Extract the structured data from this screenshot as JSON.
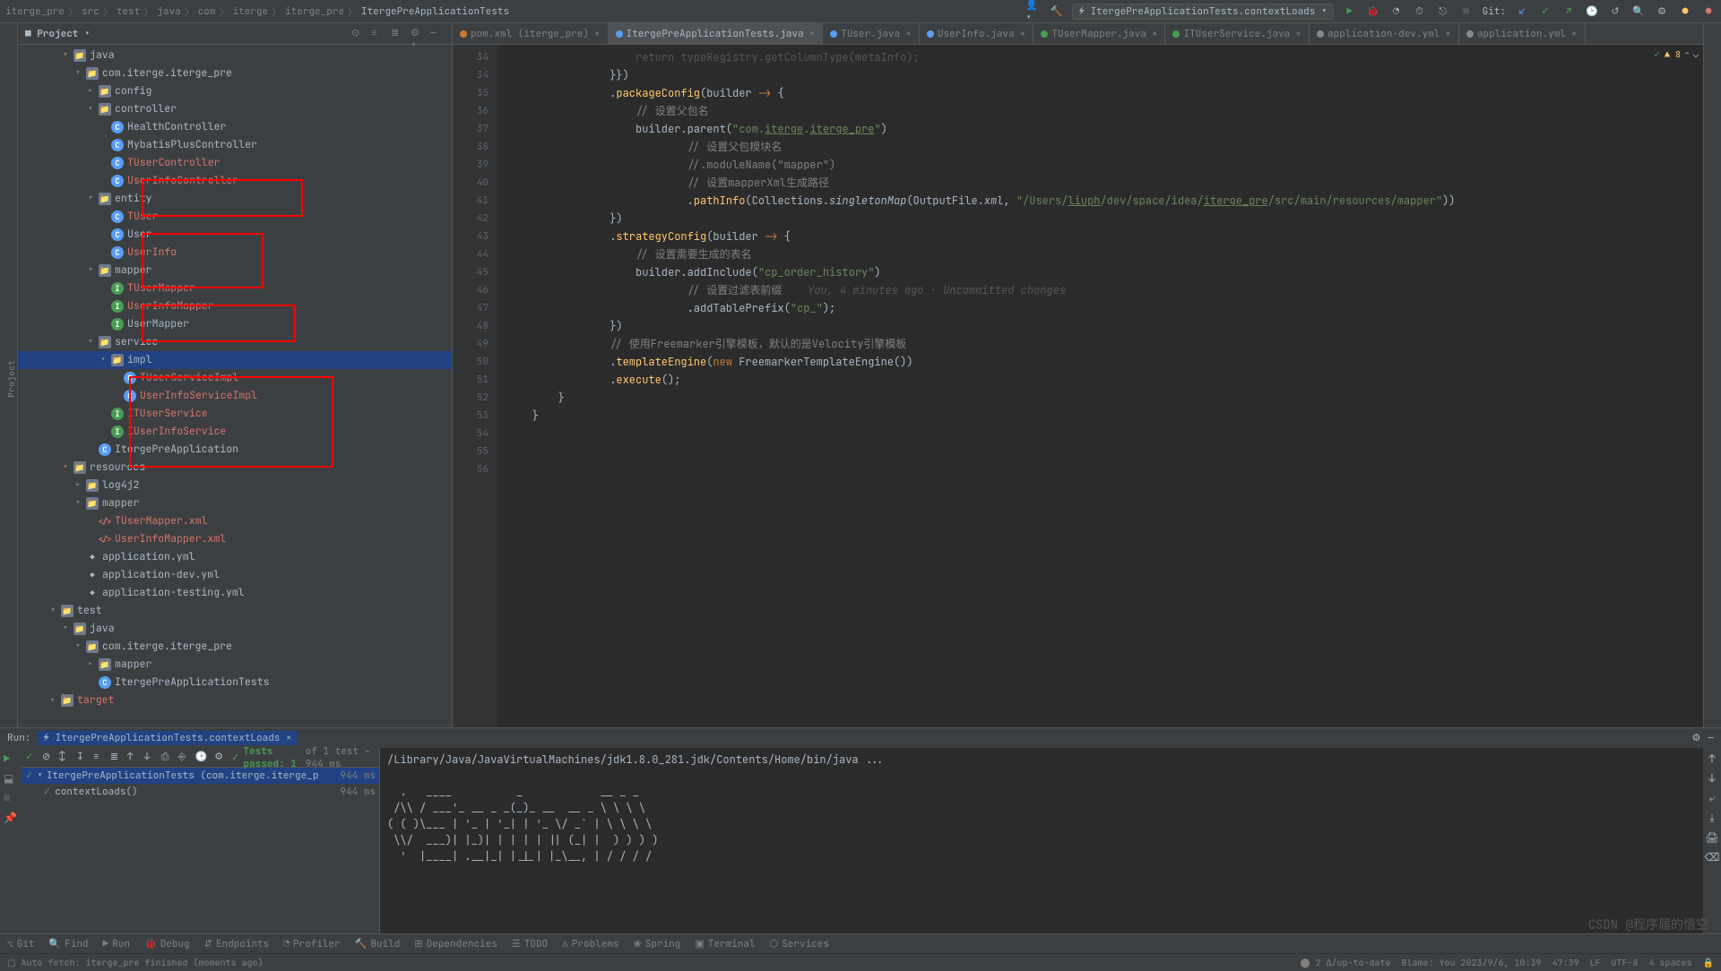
{
  "breadcrumb": [
    "iterge_pre",
    "src",
    "test",
    "java",
    "com",
    "iterge",
    "iterge_pre",
    "ItergePreApplicationTests"
  ],
  "top": {
    "runconfig": "ItergePreApplicationTests.contextLoads",
    "git_label": "Git:"
  },
  "pane": {
    "title": "Project"
  },
  "tree": [
    {
      "d": 3,
      "a": "v",
      "i": "folder",
      "t": "java",
      "cls": ""
    },
    {
      "d": 4,
      "a": "v",
      "i": "folder",
      "t": "com.iterge.iterge_pre"
    },
    {
      "d": 5,
      "a": ">",
      "i": "folder",
      "t": "config"
    },
    {
      "d": 5,
      "a": "v",
      "i": "folder",
      "t": "controller"
    },
    {
      "d": 6,
      "a": "",
      "i": "cls",
      "t": "HealthController"
    },
    {
      "d": 6,
      "a": "",
      "i": "cls",
      "t": "MybatisPlusController"
    },
    {
      "d": 6,
      "a": "",
      "i": "cls",
      "t": "TUserController",
      "c": "orange"
    },
    {
      "d": 6,
      "a": "",
      "i": "cls",
      "t": "UserInfoController",
      "c": "orange"
    },
    {
      "d": 5,
      "a": "v",
      "i": "folder",
      "t": "entity"
    },
    {
      "d": 6,
      "a": "",
      "i": "cls",
      "t": "TUser",
      "c": "orange"
    },
    {
      "d": 6,
      "a": "",
      "i": "cls",
      "t": "User"
    },
    {
      "d": 6,
      "a": "",
      "i": "cls",
      "t": "UserInfo",
      "c": "orange"
    },
    {
      "d": 5,
      "a": "v",
      "i": "folder",
      "t": "mapper"
    },
    {
      "d": 6,
      "a": "",
      "i": "iface",
      "t": "TUserMapper",
      "c": "orange"
    },
    {
      "d": 6,
      "a": "",
      "i": "iface",
      "t": "UserInfoMapper",
      "c": "orange"
    },
    {
      "d": 6,
      "a": "",
      "i": "iface",
      "t": "UserMapper"
    },
    {
      "d": 5,
      "a": "v",
      "i": "folder",
      "t": "service"
    },
    {
      "d": 6,
      "a": "v",
      "i": "folder",
      "t": "impl",
      "sel": true
    },
    {
      "d": 7,
      "a": "",
      "i": "cls",
      "t": "TUserServiceImpl",
      "c": "orange"
    },
    {
      "d": 7,
      "a": "",
      "i": "cls",
      "t": "UserInfoServiceImpl",
      "c": "orange"
    },
    {
      "d": 6,
      "a": "",
      "i": "iface",
      "t": "ITUserService",
      "c": "orange"
    },
    {
      "d": 6,
      "a": "",
      "i": "iface",
      "t": "IUserInfoService",
      "c": "orange"
    },
    {
      "d": 5,
      "a": "",
      "i": "cls",
      "t": "ItergePreApplication"
    },
    {
      "d": 3,
      "a": "v",
      "i": "folder",
      "t": "resources"
    },
    {
      "d": 4,
      "a": ">",
      "i": "folder",
      "t": "log4j2"
    },
    {
      "d": 4,
      "a": "v",
      "i": "folder",
      "t": "mapper"
    },
    {
      "d": 5,
      "a": "",
      "i": "xml",
      "t": "TUserMapper.xml",
      "c": "orange"
    },
    {
      "d": 5,
      "a": "",
      "i": "xml",
      "t": "UserInfoMapper.xml",
      "c": "orange"
    },
    {
      "d": 4,
      "a": "",
      "i": "yml",
      "t": "application.yml"
    },
    {
      "d": 4,
      "a": "",
      "i": "yml",
      "t": "application-dev.yml"
    },
    {
      "d": 4,
      "a": "",
      "i": "yml",
      "t": "application-testing.yml"
    },
    {
      "d": 2,
      "a": "v",
      "i": "folder",
      "t": "test"
    },
    {
      "d": 3,
      "a": "v",
      "i": "folder",
      "t": "java"
    },
    {
      "d": 4,
      "a": "v",
      "i": "folder",
      "t": "com.iterge.iterge_pre"
    },
    {
      "d": 5,
      "a": ">",
      "i": "folder",
      "t": "mapper"
    },
    {
      "d": 5,
      "a": "",
      "i": "cls",
      "t": "ItergePreApplicationTests"
    },
    {
      "d": 2,
      "a": ">",
      "i": "folder",
      "t": "target",
      "c": "orange"
    }
  ],
  "tabs": [
    {
      "t": "pom.xml (iterge_pre)",
      "ico": "m",
      "c": "#cc7832"
    },
    {
      "t": "ItergePreApplicationTests.java",
      "ico": "C",
      "c": "#589df6",
      "active": true
    },
    {
      "t": "TUser.java",
      "ico": "C",
      "c": "#589df6"
    },
    {
      "t": "UserInfo.java",
      "ico": "C",
      "c": "#589df6"
    },
    {
      "t": "TUserMapper.java",
      "ico": "I",
      "c": "#499c54"
    },
    {
      "t": "ITUserService.java",
      "ico": "I",
      "c": "#499c54"
    },
    {
      "t": "application-dev.yml",
      "ico": "y",
      "c": "#888"
    },
    {
      "t": "application.yml",
      "ico": "y",
      "c": "#888"
    }
  ],
  "editor": {
    "badge": "▲ 8",
    "lines": [
      {
        "n": 34,
        "raw": "                    return typeRegistry.getColumnType(metaInfo);",
        "dim": true
      },
      {
        "n": 34,
        "h": ""
      },
      {
        "n": 35,
        "h": "                }})"
      },
      {
        "n": 36,
        "h": "                .<fn>packageConfig</fn>(builder <kw>-></kw> {"
      },
      {
        "n": 37,
        "h": "                    <cm>// 设置父包名</cm>"
      },
      {
        "n": 38,
        "h": "                    builder.parent(<str>\"com.<u>iterge</u>.<u>iterge_pre</u>\"</str>)"
      },
      {
        "n": 39,
        "h": "                            <cm>// 设置父包模块名</cm>"
      },
      {
        "n": 40,
        "h": "                            <cm>//.moduleName(\"mapper\")</cm>"
      },
      {
        "n": 41,
        "h": "                            <cm>// 设置mapperXml生成路径</cm>"
      },
      {
        "n": 42,
        "h": "                            .<fn>pathInfo</fn>(Collections.<it>singletonMap</it>(OutputFile.<it>xml</it>, <str>\"/Users/<u>liuph</u>/dev/space/idea/<u>iterge_pre</u>/src/main/resources/mapper\"</str>))"
      },
      {
        "n": 43,
        "h": "                })"
      },
      {
        "n": 44,
        "h": "                .<fn>strategyConfig</fn>(builder <kw>-></kw> {"
      },
      {
        "n": 45,
        "h": "                    <cm>// 设置需要生成的表名</cm>"
      },
      {
        "n": 46,
        "h": "                    builder.addInclude(<str>\"cp_order_history\"</str>)"
      },
      {
        "n": 47,
        "h": "                            <cm>// 设置过滤表前缀</cm>    <hint>You, 4 minutes ago · Uncommitted changes</hint>"
      },
      {
        "n": 48,
        "h": "                            .addTablePrefix(<str>\"cp_\"</str>);"
      },
      {
        "n": 49,
        "h": "                })"
      },
      {
        "n": 50,
        "h": "                <cm>// 使用Freemarker引擎模板，默认的是Velocity引擎模板</cm>"
      },
      {
        "n": 51,
        "h": "                .<fn>templateEngine</fn>(<kw>new</kw> FreemarkerTemplateEngine())"
      },
      {
        "n": 52,
        "h": "                .<fn>execute</fn>();"
      },
      {
        "n": 53,
        "h": ""
      },
      {
        "n": 54,
        "h": "        }"
      },
      {
        "n": 55,
        "h": "    }"
      },
      {
        "n": 56,
        "h": ""
      }
    ]
  },
  "run": {
    "title": "Run:",
    "tab": "ItergePreApplicationTests.contextLoads",
    "status_prefix": "Tests passed: 1",
    "status_suffix": " of 1 test – 944 ms",
    "root": "ItergePreApplicationTests (com.iterge.iterge_p",
    "root_time": "944 ms",
    "child": "contextLoads()",
    "child_time": "944 ms",
    "console0": "/Library/Java/JavaVirtualMachines/jdk1.8.0_281.jdk/Contents/Home/bin/java ...",
    "ascii": "  .   ____          _            __ _ _\n /\\\\ / ___'_ __ _ _(_)_ __  __ _ \\ \\ \\ \\\n( ( )\\___ | '_ | '_| | '_ \\/ _` | \\ \\ \\ \\\n \\\\/  ___)| |_)| | | | | || (_| |  ) ) ) )\n  '  |____| .__|_| |_|_| |_\\__, | / / / /"
  },
  "bottom": {
    "git": "Git",
    "find": "Find",
    "run": "Run",
    "debug": "Debug",
    "endpoints": "Endpoints",
    "profiler": "Profiler",
    "build": "Build",
    "dependencies": "Dependencies",
    "todo": "TODO",
    "problems": "Problems",
    "spring": "Spring",
    "terminal": "Terminal",
    "services": "Services"
  },
  "status": {
    "left": "Auto fetch: iterge_pre finished (moments ago)",
    "vcs": "2 ∆/up-to-date",
    "blame": "Blame: You 2023/9/6, 10:39",
    "pos": "47:39",
    "sep": "LF",
    "enc": "UTF-8",
    "spaces": "4 spaces"
  },
  "watermark": "CSDN @程序届的悟空"
}
